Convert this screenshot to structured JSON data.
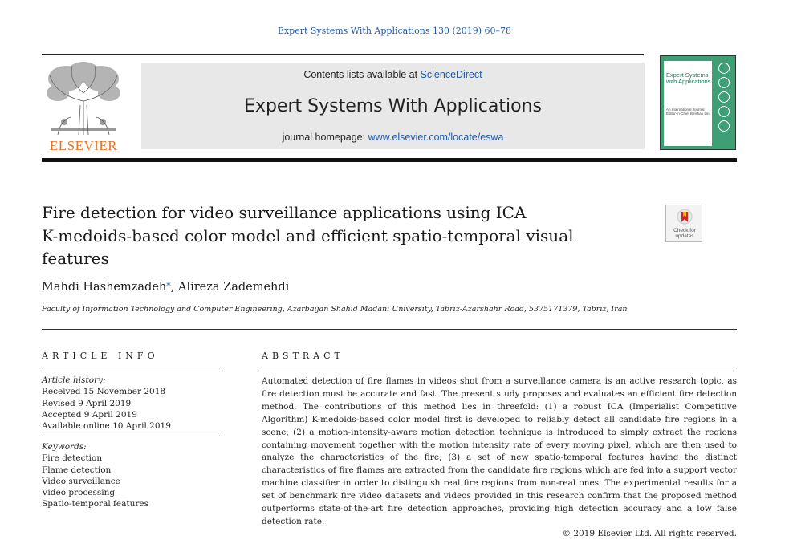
{
  "header": {
    "journal_ref": "Expert Systems With Applications 130 (2019) 60–78",
    "publisher_logo": "ELSEVIER",
    "contents_prefix": "Contents lists available at ",
    "contents_link": "ScienceDirect",
    "journal_title": "Expert Systems With Applications",
    "homepage_prefix": "journal homepage: ",
    "homepage_link": "www.elsevier.com/locate/eswa",
    "cover_title": "Expert Systems with Applications",
    "cover_subtitle": "An International Journal",
    "cover_editor": "Editor-in-Chief Binshan Lin",
    "colors": {
      "link": "#1f5aa6",
      "elsevier_orange": "#e9711c",
      "cover_green": "#3e9e74"
    }
  },
  "article": {
    "title_line1": "Fire detection for video surveillance applications using ICA",
    "title_line2": "K-medoids-based color model and efficient spatio-temporal visual",
    "title_line3": "features",
    "check_updates_label": "Check for updates",
    "author1": "Mahdi Hashemzadeh",
    "author_mark": "*",
    "author_sep": ", ",
    "author2": "Alireza Zademehdi",
    "affiliation": "Faculty of Information Technology and Computer Engineering, Azarbaijan Shahid Madani University, Tabriz-Azarshahr Road, 5375171379, Tabriz, Iran"
  },
  "article_info": {
    "heading": "ARTICLE INFO",
    "history_label": "Article history:",
    "history": [
      "Received 15 November 2018",
      "Revised 9 April 2019",
      "Accepted 9 April 2019",
      "Available online 10 April 2019"
    ],
    "keywords_label": "Keywords:",
    "keywords": [
      "Fire detection",
      "Flame detection",
      "Video surveillance",
      "Video processing",
      "Spatio-temporal features"
    ]
  },
  "abstract": {
    "heading": "ABSTRACT",
    "text": "Automated detection of fire flames in videos shot from a surveillance camera is an active research topic, as fire detection must be accurate and fast. The present study proposes and evaluates an efficient fire detection method. The contributions of this method lies in threefold: (1) a robust ICA (Imperialist Competitive Algorithm) K-medoids-based color model first is developed to reliably detect all candidate fire regions in a scene; (2) a motion-intensity-aware motion detection technique is introduced to simply extract the regions containing movement together with the motion intensity rate of every moving pixel, which are then used to analyze the characteristics of the fire; (3) a set of new spatio-temporal features having the distinct characteristics of fire flames are extracted from the candidate fire regions which are fed into a support vector machine classifier in order to distinguish real fire regions from non-real ones. The experimental results for a set of benchmark fire video datasets and videos provided in this research confirm that the proposed method outperforms state-of-the-art fire detection approaches, providing high detection accuracy and a low false detection rate.",
    "copyright": "© 2019 Elsevier Ltd. All rights reserved."
  }
}
